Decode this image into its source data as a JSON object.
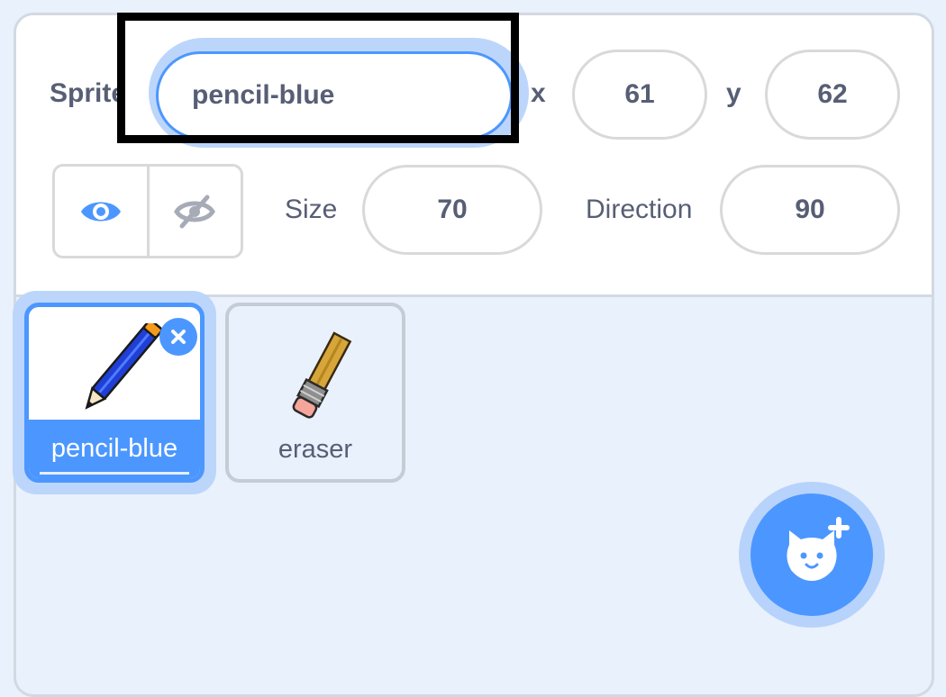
{
  "sprite_info": {
    "sprite_label": "Sprite",
    "sprite_name": "pencil-blue",
    "x_label": "x",
    "x_value": "61",
    "y_label": "y",
    "y_value": "62",
    "size_label": "Size",
    "size_value": "70",
    "direction_label": "Direction",
    "direction_value": "90",
    "show_icon": "eye-icon",
    "hide_icon": "eye-slash-icon"
  },
  "sprites": [
    {
      "name": "pencil-blue",
      "selected": true,
      "icon": "blue-pencil"
    },
    {
      "name": "eraser",
      "selected": false,
      "icon": "eraser-pencil"
    }
  ],
  "actions": {
    "add_sprite_icon": "cat-plus-icon"
  },
  "colors": {
    "accent": "#4c97ff",
    "text": "#575e75",
    "panel_bg": "#e9f1fc"
  }
}
